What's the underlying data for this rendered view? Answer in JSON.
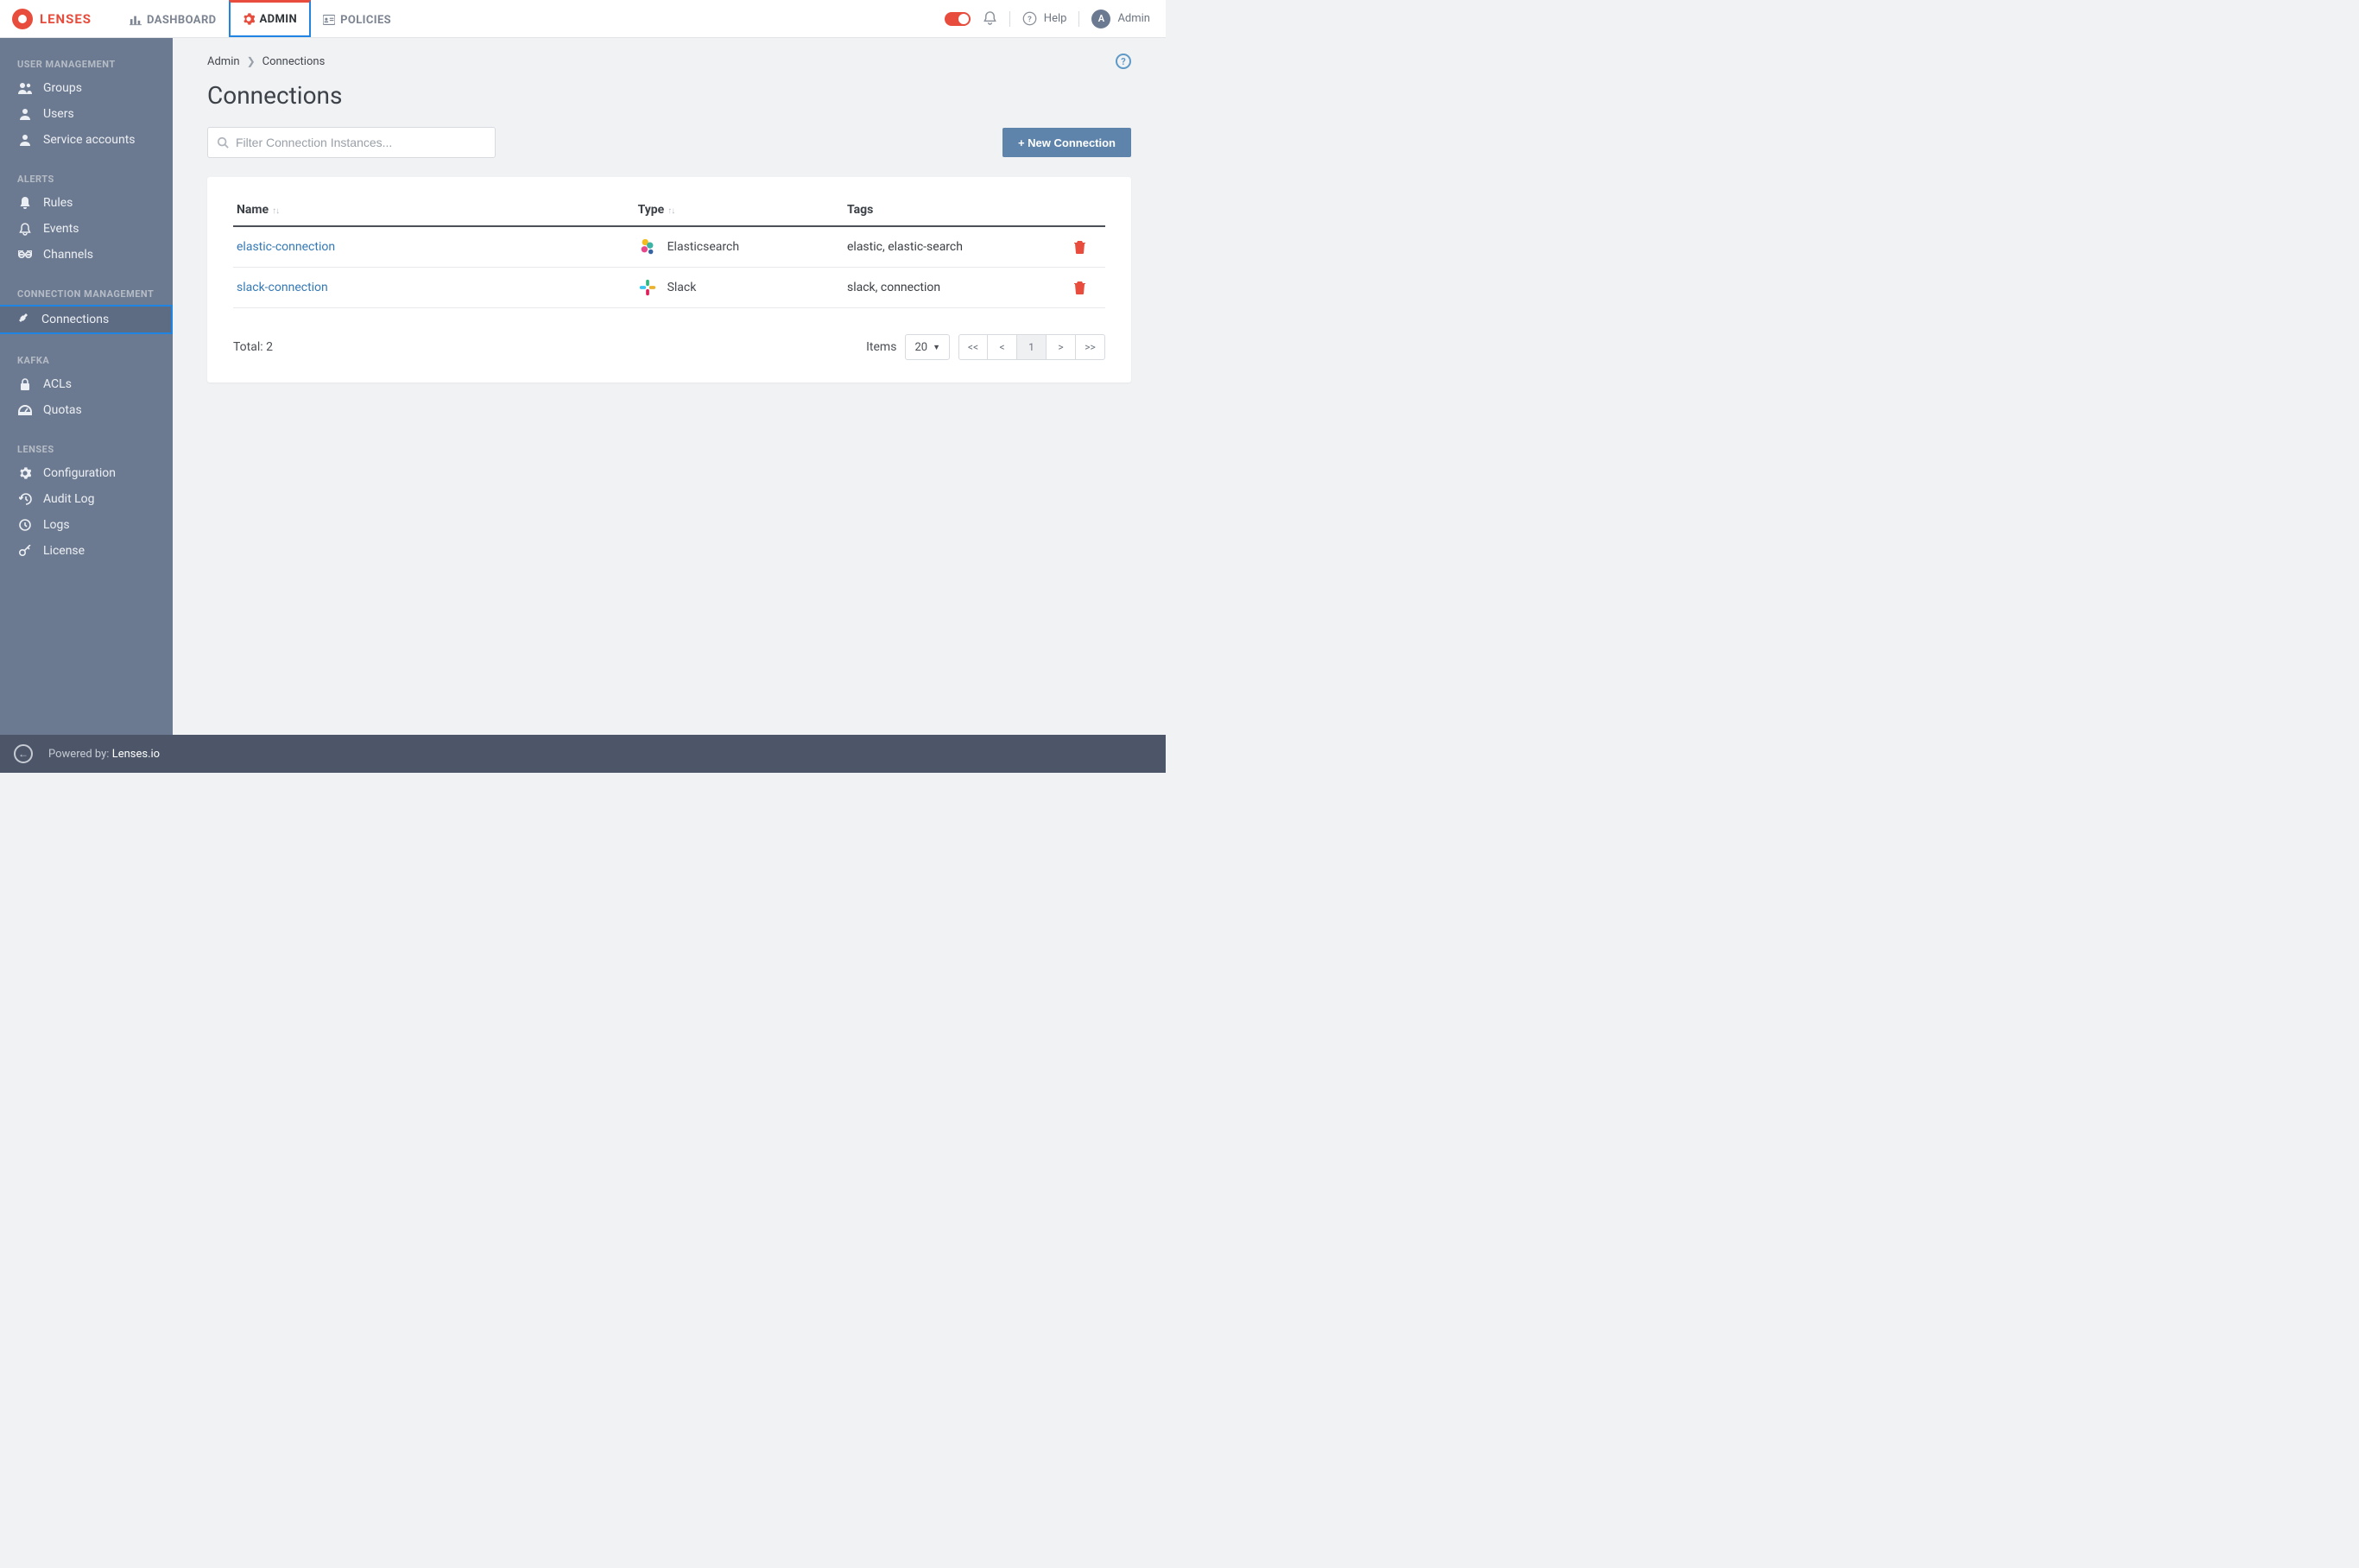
{
  "brand": {
    "name": "LENSES"
  },
  "top_tabs": [
    {
      "icon": "bar-chart-icon",
      "label": "DASHBOARD"
    },
    {
      "icon": "gear-icon",
      "label": "ADMIN"
    },
    {
      "icon": "id-card-icon",
      "label": "POLICIES"
    }
  ],
  "top_right": {
    "help_label": "Help",
    "user_initial": "A",
    "user_name": "Admin"
  },
  "sidebar": {
    "sections": [
      {
        "title": "USER MANAGEMENT",
        "items": [
          {
            "icon": "group-icon",
            "label": "Groups"
          },
          {
            "icon": "user-icon",
            "label": "Users"
          },
          {
            "icon": "user-icon",
            "label": "Service accounts"
          }
        ]
      },
      {
        "title": "ALERTS",
        "items": [
          {
            "icon": "bell-solid-icon",
            "label": "Rules"
          },
          {
            "icon": "bell-outline-icon",
            "label": "Events"
          },
          {
            "icon": "link-icon",
            "label": "Channels"
          }
        ]
      },
      {
        "title": "CONNECTION MANAGEMENT",
        "items": [
          {
            "icon": "plug-icon",
            "label": "Connections",
            "active": true
          }
        ]
      },
      {
        "title": "KAFKA",
        "items": [
          {
            "icon": "lock-icon",
            "label": "ACLs"
          },
          {
            "icon": "gauge-icon",
            "label": "Quotas"
          }
        ]
      },
      {
        "title": "LENSES",
        "items": [
          {
            "icon": "gear-icon",
            "label": "Configuration"
          },
          {
            "icon": "history-icon",
            "label": "Audit Log"
          },
          {
            "icon": "clock-icon",
            "label": "Logs"
          },
          {
            "icon": "key-icon",
            "label": "License"
          }
        ]
      }
    ]
  },
  "breadcrumb": {
    "parent": "Admin",
    "current": "Connections"
  },
  "page_title": "Connections",
  "filter_placeholder": "Filter Connection Instances...",
  "new_button": "+ New Connection",
  "table": {
    "headers": {
      "name": "Name",
      "type": "Type",
      "tags": "Tags"
    },
    "rows": [
      {
        "name": "elastic-connection",
        "type": "Elasticsearch",
        "type_icon": "elasticsearch-icon",
        "tags": "elastic, elastic-search"
      },
      {
        "name": "slack-connection",
        "type": "Slack",
        "type_icon": "slack-icon",
        "tags": "slack, connection"
      }
    ],
    "total_label": "Total: 2"
  },
  "pagination": {
    "items_label": "Items",
    "page_size": "20",
    "current_page": "1",
    "first": "<<",
    "prev": "<",
    "next": ">",
    "last": ">>"
  },
  "footer": {
    "prefix": "Powered by: ",
    "link": "Lenses.io"
  }
}
